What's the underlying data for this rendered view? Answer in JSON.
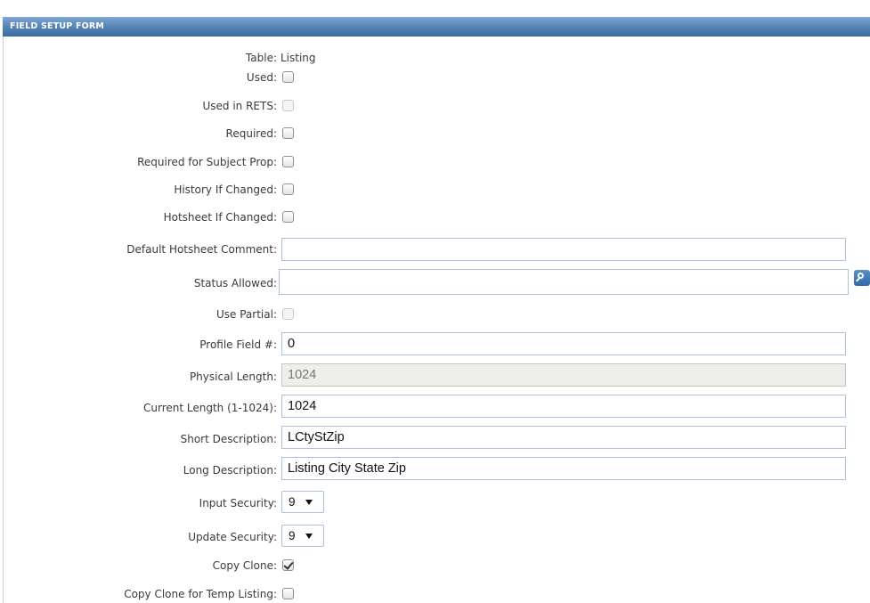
{
  "header": {
    "title": "FIELD SETUP FORM"
  },
  "labels": {
    "table": "Table:",
    "used": "Used:",
    "used_in_rets": "Used in RETS:",
    "required": "Required:",
    "required_subject": "Required for Subject Prop:",
    "history_changed": "History If Changed:",
    "hotsheet_changed": "Hotsheet If Changed:",
    "default_hotsheet_comment": "Default Hotsheet Comment:",
    "status_allowed": "Status Allowed:",
    "use_partial": "Use Partial:",
    "profile_field": "Profile Field #:",
    "physical_length": "Physical Length:",
    "current_length": "Current Length (1-1024):",
    "short_description": "Short Description:",
    "long_description": "Long Description:",
    "input_security": "Input Security:",
    "update_security": "Update Security:",
    "copy_clone": "Copy Clone:",
    "copy_clone_temp": "Copy Clone for Temp Listing:"
  },
  "values": {
    "table": "Listing",
    "default_hotsheet_comment": "",
    "status_allowed": "",
    "profile_field": "0",
    "physical_length": "1024",
    "current_length": "1024",
    "short_description": "LCtyStZip",
    "long_description": "Listing City State Zip",
    "input_security": "9",
    "update_security": "9"
  },
  "checkboxes": {
    "used": false,
    "used_in_rets": false,
    "required": false,
    "required_subject": false,
    "history_changed": false,
    "hotsheet_changed": false,
    "use_partial": false,
    "copy_clone": true,
    "copy_clone_temp": false
  },
  "icons": {
    "status_lookup": "search-icon"
  },
  "colors": {
    "header": "#4a79ad",
    "input_border": "#a9c1dc",
    "readonly_bg": "#eeeeeb"
  }
}
